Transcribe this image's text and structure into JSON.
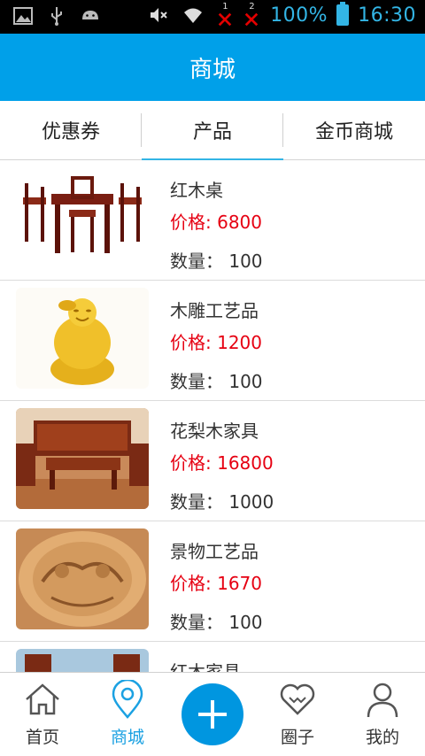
{
  "status_bar": {
    "battery_percent": "100%",
    "time": "16:30",
    "icons": [
      "image-icon",
      "usb-icon",
      "android-icon",
      "mute-icon",
      "wifi-icon",
      "signal-1-icon",
      "signal-2-icon",
      "battery-icon"
    ],
    "sim_labels": [
      "1",
      "2"
    ]
  },
  "header": {
    "title": "商城"
  },
  "tabs": [
    {
      "label": "优惠券"
    },
    {
      "label": "产品"
    },
    {
      "label": "金币商城"
    }
  ],
  "active_tab": "产品",
  "products": [
    {
      "name": "红木桌",
      "price": "价格: 6800",
      "quantity": "数量： 100",
      "image": "rosewood-table-set"
    },
    {
      "name": "木雕工艺品",
      "price": "价格: 1200",
      "quantity": "数量： 100",
      "image": "wood-carved-buddha"
    },
    {
      "name": "花梨木家具",
      "price": "价格: 16800",
      "quantity": "数量： 1000",
      "image": "rosewood-living-room-set"
    },
    {
      "name": "景物工艺品",
      "price": "价格: 1670",
      "quantity": "数量： 100",
      "image": "carved-wood-panel"
    },
    {
      "name": "红木家具",
      "price": "",
      "quantity": "",
      "image": "rosewood-furniture"
    }
  ],
  "bottom_nav": [
    {
      "label": "首页",
      "icon": "home-icon"
    },
    {
      "label": "商城",
      "icon": "location-pin-icon"
    },
    {
      "label": "",
      "icon": "add-icon"
    },
    {
      "label": "圈子",
      "icon": "heart-icon"
    },
    {
      "label": "我的",
      "icon": "user-icon"
    }
  ],
  "colors": {
    "accent": "#00a0e9",
    "price": "#e60012",
    "status_text": "#33b5e5"
  }
}
